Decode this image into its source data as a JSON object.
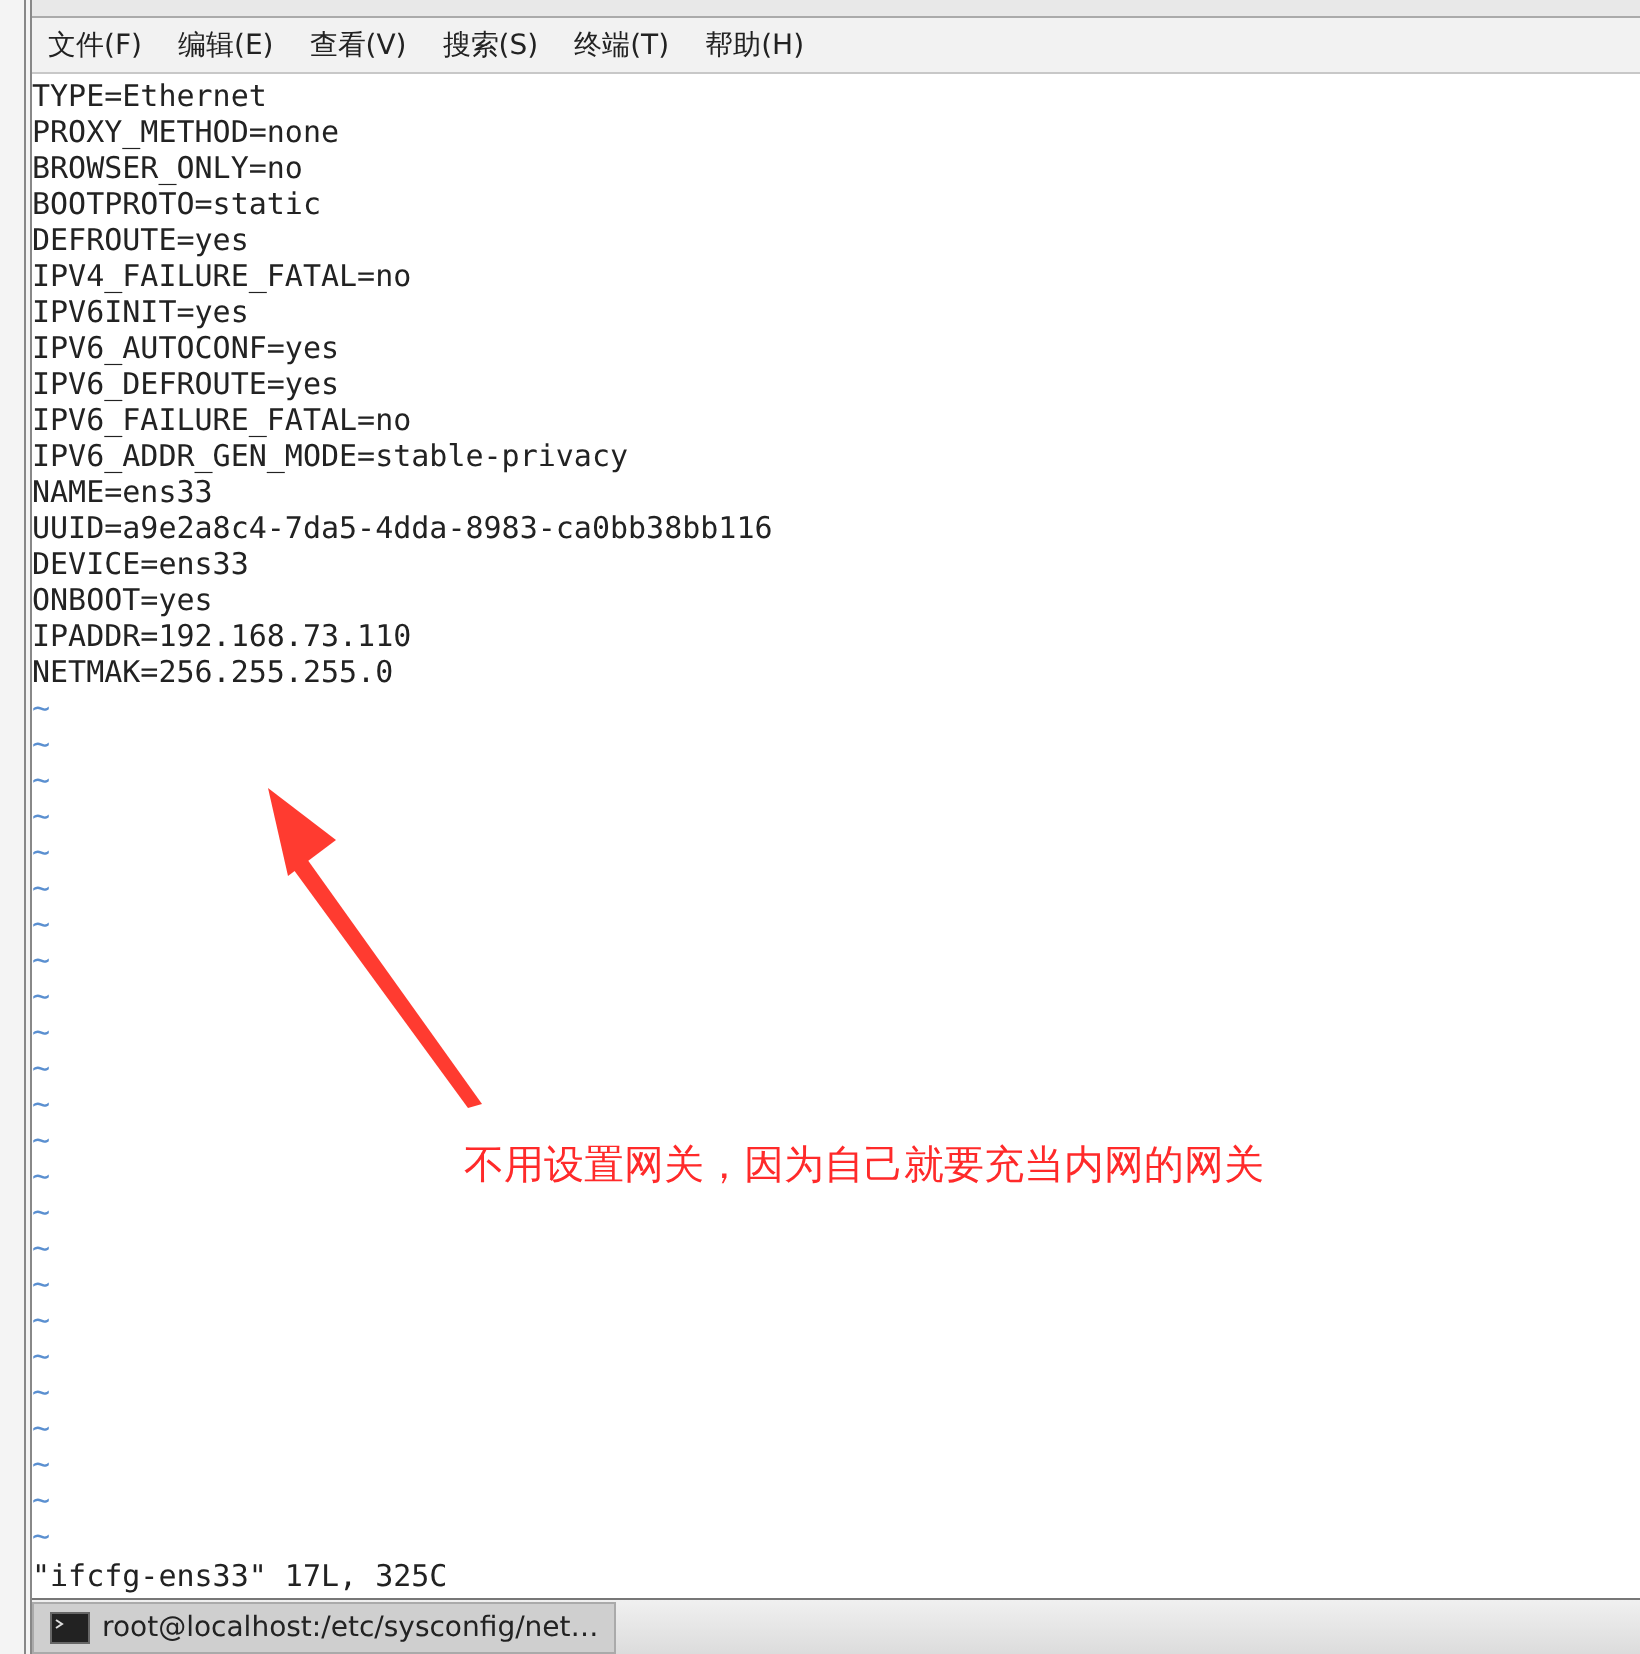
{
  "menu": [
    {
      "label": "文件(F)"
    },
    {
      "label": "编辑(E)"
    },
    {
      "label": "查看(V)"
    },
    {
      "label": "搜索(S)"
    },
    {
      "label": "终端(T)"
    },
    {
      "label": "帮助(H)"
    }
  ],
  "editor": {
    "lines": [
      "TYPE=Ethernet",
      "PROXY_METHOD=none",
      "BROWSER_ONLY=no",
      "BOOTPROTO=static",
      "DEFROUTE=yes",
      "IPV4_FAILURE_FATAL=no",
      "IPV6INIT=yes",
      "IPV6_AUTOCONF=yes",
      "IPV6_DEFROUTE=yes",
      "IPV6_FAILURE_FATAL=no",
      "IPV6_ADDR_GEN_MODE=stable-privacy",
      "NAME=ens33",
      "UUID=a9e2a8c4-7da5-4dda-8983-ca0bb38bb116",
      "DEVICE=ens33",
      "ONBOOT=yes",
      "IPADDR=192.168.73.110",
      "NETMAK=256.255.255.0"
    ],
    "empty_lines": [
      "~",
      "~",
      "~",
      "~",
      "~",
      "~",
      "~",
      "~",
      "~",
      "~",
      "~",
      "~",
      "~",
      "~",
      "~",
      "~",
      "~",
      "~",
      "~",
      "~",
      "~",
      "~",
      "~",
      "~"
    ],
    "status_line": "\"ifcfg-ens33\" 17L, 325C"
  },
  "annotation": {
    "text": "不用设置网关，因为自己就要充当内网的网关"
  },
  "taskbar": {
    "items": [
      {
        "label": "root@localhost:/etc/sysconfig/net…",
        "selected": true
      }
    ]
  }
}
